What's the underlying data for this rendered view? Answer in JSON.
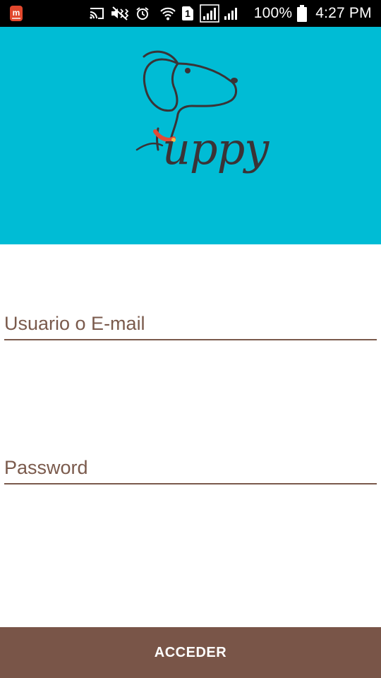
{
  "status_bar": {
    "battery_percent": "100%",
    "time": "4:27 PM",
    "sim_slot": "1",
    "icons": [
      "app-notification-icon",
      "cast-icon",
      "mute-vibrate-icon",
      "alarm-icon",
      "wifi-icon",
      "sim-1-icon",
      "signal-icon",
      "signal-secondary-icon",
      "battery-icon"
    ]
  },
  "header": {
    "background_color": "#00BCD5",
    "logo_text": "uppy",
    "logo_icon": "dog-icon"
  },
  "form": {
    "username_placeholder": "Usuario o E-mail",
    "username_value": "",
    "password_placeholder": "Password",
    "password_value": "",
    "accent_color": "#795548"
  },
  "actions": {
    "submit_label": "ACCEDER"
  }
}
